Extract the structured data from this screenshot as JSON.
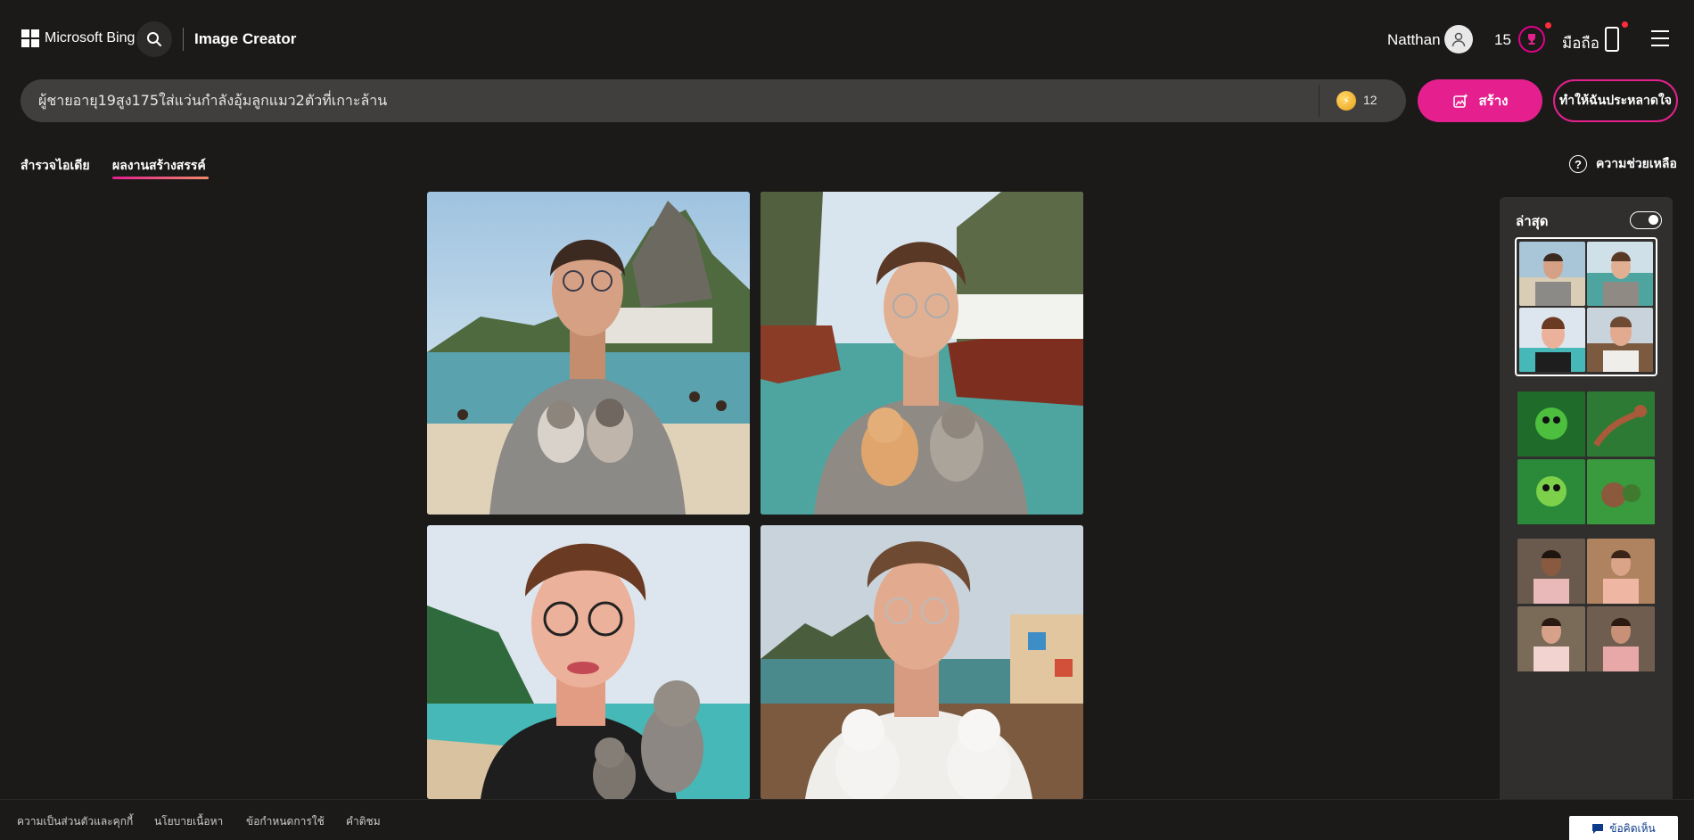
{
  "header": {
    "brand": "Microsoft Bing",
    "app_title": "Image Creator",
    "user_name": "Natthan",
    "reward_count": "15",
    "mobile_label": "มือถือ"
  },
  "prompt": {
    "value": "ผู้ชายอายุ19สูง175ใส่แว่นกำลังอุ้มลูกแมว2ตัวที่เกาะล้าน",
    "boosts": "12",
    "create_label": "สร้าง",
    "surprise_label": "ทำให้ฉันประหลาดใจ"
  },
  "tabs": [
    {
      "label": "สำรวจไอเดีย",
      "active": false
    },
    {
      "label": "ผลงานสร้างสรรค์",
      "active": true
    }
  ],
  "help_label": "ความช่วยเหลือ",
  "images": [
    {
      "name": "generated-image-1"
    },
    {
      "name": "generated-image-2"
    },
    {
      "name": "generated-image-3"
    },
    {
      "name": "generated-image-4"
    }
  ],
  "recent_panel": {
    "title": "ล่าสุด",
    "toggle_on": true
  },
  "footer": {
    "links": [
      "ความเป็นส่วนตัวและคุกกี้",
      "นโยบายเนื้อหา",
      "ข้อกำหนดการใช้",
      "คำติชม"
    ],
    "feedback_label": "ข้อคิดเห็น"
  },
  "colors": {
    "accent": "#e5208e",
    "background": "#1b1a19",
    "panel": "#302f2e",
    "prompt_bar": "#403f3e"
  }
}
